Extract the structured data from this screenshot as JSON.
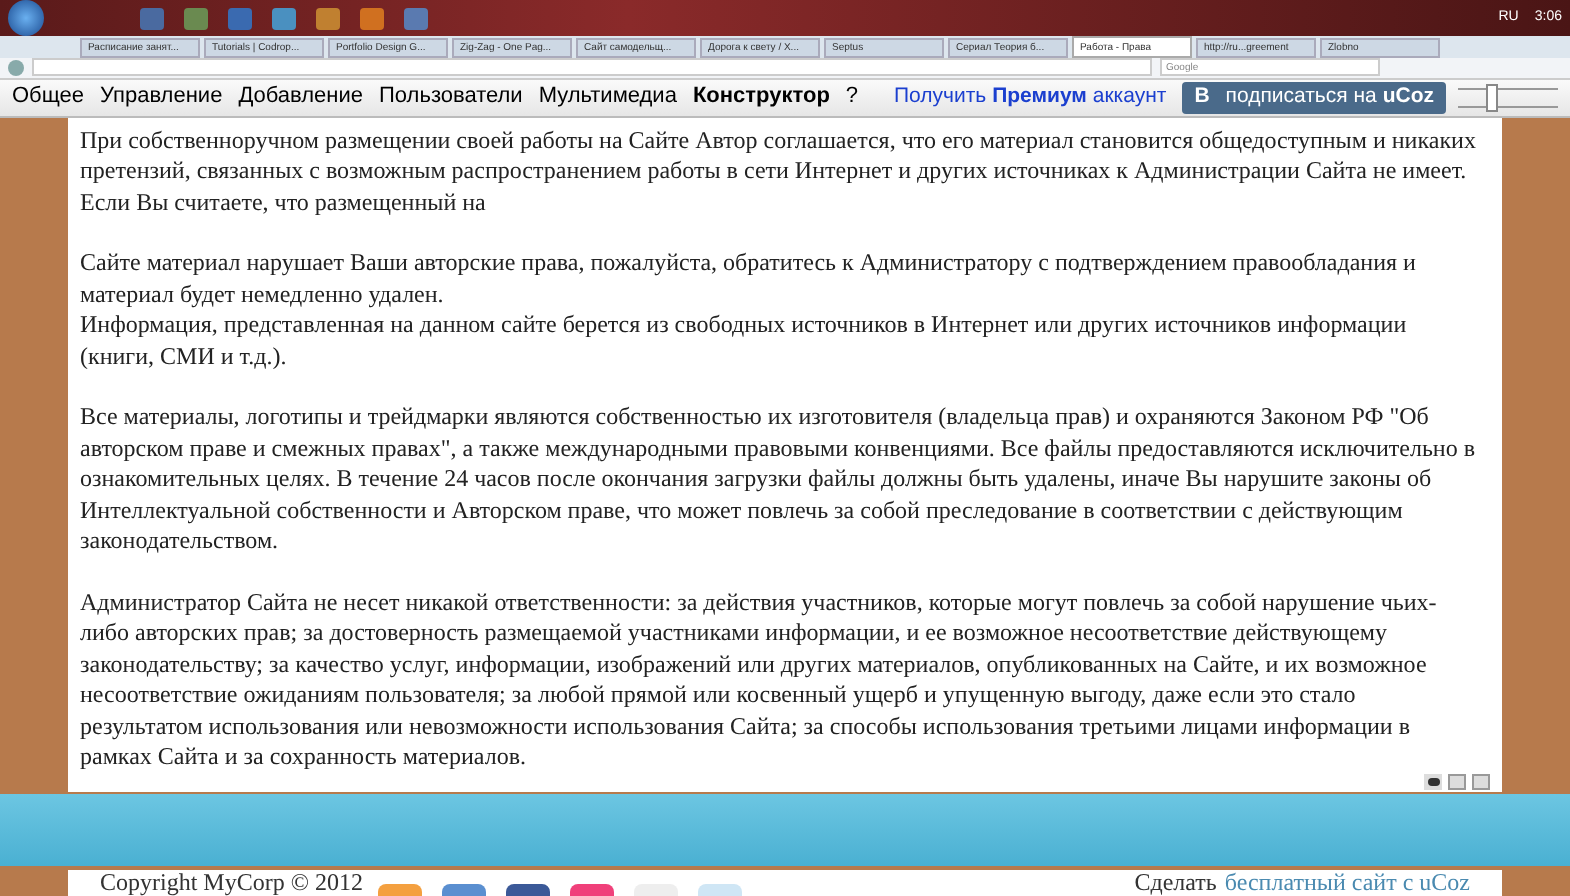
{
  "browser_tabs": [
    {
      "title": "Расписание занят...",
      "selected": false
    },
    {
      "title": "Tutorials | Codrop...",
      "selected": false
    },
    {
      "title": "Portfolio Design G...",
      "selected": false
    },
    {
      "title": "Zig-Zag - One Pag...",
      "selected": false
    },
    {
      "title": "Сайт самодельщ...",
      "selected": false
    },
    {
      "title": "Дорога к свету / X...",
      "selected": false
    },
    {
      "title": "Septus",
      "selected": false
    },
    {
      "title": "Сериал Теория б...",
      "selected": false
    },
    {
      "title": "Работа - Права",
      "selected": true
    },
    {
      "title": "http://ru...greement",
      "selected": false
    },
    {
      "title": "Zlobno",
      "selected": false
    }
  ],
  "tray": {
    "language": "RU",
    "time": "3:06"
  },
  "search_box": {
    "placeholder": "Google"
  },
  "ucoz_menu": [
    {
      "label": "Общее",
      "bold": false
    },
    {
      "label": "Управление",
      "bold": false
    },
    {
      "label": "Добавление",
      "bold": false
    },
    {
      "label": "Пользователи",
      "bold": false
    },
    {
      "label": "Мультимедиа",
      "bold": false
    },
    {
      "label": "Конструктор",
      "bold": true
    },
    {
      "label": "?",
      "bold": false
    }
  ],
  "premium_link": "Получить **Премиум** аккаунт",
  "subscribe_button": {
    "icon": "B",
    "label": "подписаться на **uCoz**"
  },
  "paragraphs": [
    "При собственноручном размещении своей работы на Сайте Автор соглашается, что его материал становится общедоступным и никаких претензий, связанных с возможным распространением работы в сети Интернет и других источниках к Администрации Сайта не имеет. Если Вы считаете, что размещенный на",
    "Сайте материал нарушает Ваши авторские права, пожалуйста, обратитесь к Администратору с подтверждением правообладания и материал будет немедленно удален.\nИнформация, представленная на данном сайте берется из свободных источников в Интернет или других источников информации (книги, СМИ и т.д.).",
    "Все материалы, логотипы и трейдмарки являются собственностью их изготовителя (владельца прав) и охраняются Законом РФ \"Об авторском праве и смежных правах\", а также международными правовыми конвенциями. Все файлы предоставляются исключительно в ознакомительных целях. В течение 24 часов после окончания загрузки файлы должны быть удалены, иначе Вы нарушите законы об Интеллектуальной собственности и Авторском праве, что может повлечь за собой преследование в соответствии с действующим законодательством.",
    " Администратор Сайта не несет никакой ответственности: за действия участников, которые могут повлечь за собой нарушение чьих-либо авторских прав; за достоверность размещаемой участниками информации, и ее возможное несоответствие действующему законодательству; за качество услуг, информации, изображений или других материалов, опубликованных на Сайте, и их возможное несоответствие ожиданиям пользователя; за любой прямой или косвенный ущерб и упущенную выгоду, даже если это стало результатом использования или невозможности использования Сайта; за способы использования третьими лицами информации в рамках Сайта и за сохранность материалов."
  ],
  "footer": {
    "copyright": "Copyright MyCorp © 2012",
    "share_icons": [
      {
        "color": "#f4a040"
      },
      {
        "color": "#5a8fd0"
      },
      {
        "color": "#3b5998"
      },
      {
        "color": "#f0407a"
      },
      {
        "color": "#eeeeee"
      },
      {
        "color": "#cfe6f5"
      }
    ],
    "ucoz_prefix": "Сделать",
    "ucoz_link": "бесплатный сайт с uCoz"
  }
}
